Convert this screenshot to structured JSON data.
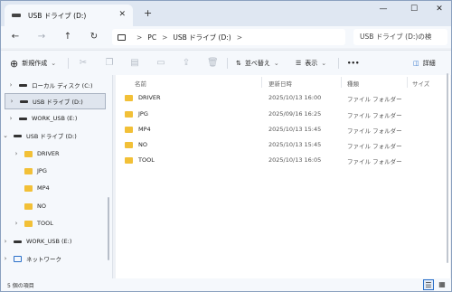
{
  "titlebar": {
    "tab_title": "USB ドライブ (D:)",
    "tab_close": "✕",
    "new_tab": "+",
    "minimize": "—",
    "maximize": "☐",
    "close": "✕"
  },
  "nav_buttons": {
    "back": "←",
    "forward": "→",
    "up": "↑",
    "refresh": "↻"
  },
  "address": {
    "segments": [
      "PC",
      "USB ドライブ (D:)"
    ],
    "sep": ">",
    "tail": ">"
  },
  "search": {
    "placeholder": "USB ドライブ (D:)の検"
  },
  "commands": {
    "new_label": "新規作成",
    "sort_label": "並べ替え",
    "view_label": "表示",
    "more_label": "•••",
    "details_label": "詳細",
    "icons": [
      "cut-icon",
      "copy-icon",
      "paste-icon",
      "rename-icon",
      "share-icon",
      "delete-icon"
    ]
  },
  "nav_items": [
    {
      "label": "ローカル ディスク (C:)",
      "chev": "›",
      "kind": "drive"
    },
    {
      "label": "USB ドライブ (D:)",
      "chev": "›",
      "kind": "drive",
      "selected": true
    },
    {
      "label": "WORK_USB (E:)",
      "chev": "›",
      "kind": "drive"
    },
    {
      "label": "USB ドライブ (D:)",
      "chev": "⌄",
      "kind": "drive"
    },
    {
      "label": "DRIVER",
      "chev": "›",
      "kind": "folder"
    },
    {
      "label": "JPG",
      "chev": "",
      "kind": "folder"
    },
    {
      "label": "MP4",
      "chev": "",
      "kind": "folder"
    },
    {
      "label": "NO",
      "chev": "",
      "kind": "folder"
    },
    {
      "label": "TOOL",
      "chev": "›",
      "kind": "folder"
    },
    {
      "label": "WORK_USB (E:)",
      "chev": "›",
      "kind": "drive"
    },
    {
      "label": "ネットワーク",
      "chev": "›",
      "kind": "network"
    }
  ],
  "columns": {
    "name": "名前",
    "date": "更新日時",
    "type": "種類",
    "size": "サイズ"
  },
  "files": [
    {
      "name": "DRIVER",
      "date": "2025/10/13 16:00",
      "type": "ファイル フォルダー"
    },
    {
      "name": "JPG",
      "date": "2025/09/16 16:25",
      "type": "ファイル フォルダー"
    },
    {
      "name": "MP4",
      "date": "2025/10/13 15:45",
      "type": "ファイル フォルダー"
    },
    {
      "name": "NO",
      "date": "2025/10/13 15:45",
      "type": "ファイル フォルダー"
    },
    {
      "name": "TOOL",
      "date": "2025/10/13 16:05",
      "type": "ファイル フォルダー"
    }
  ],
  "status": {
    "count_text": "5 個の項目"
  },
  "colors": {
    "folder": "#f2c037",
    "accent": "#2a6fc9",
    "frame": "#dfe7f2"
  }
}
